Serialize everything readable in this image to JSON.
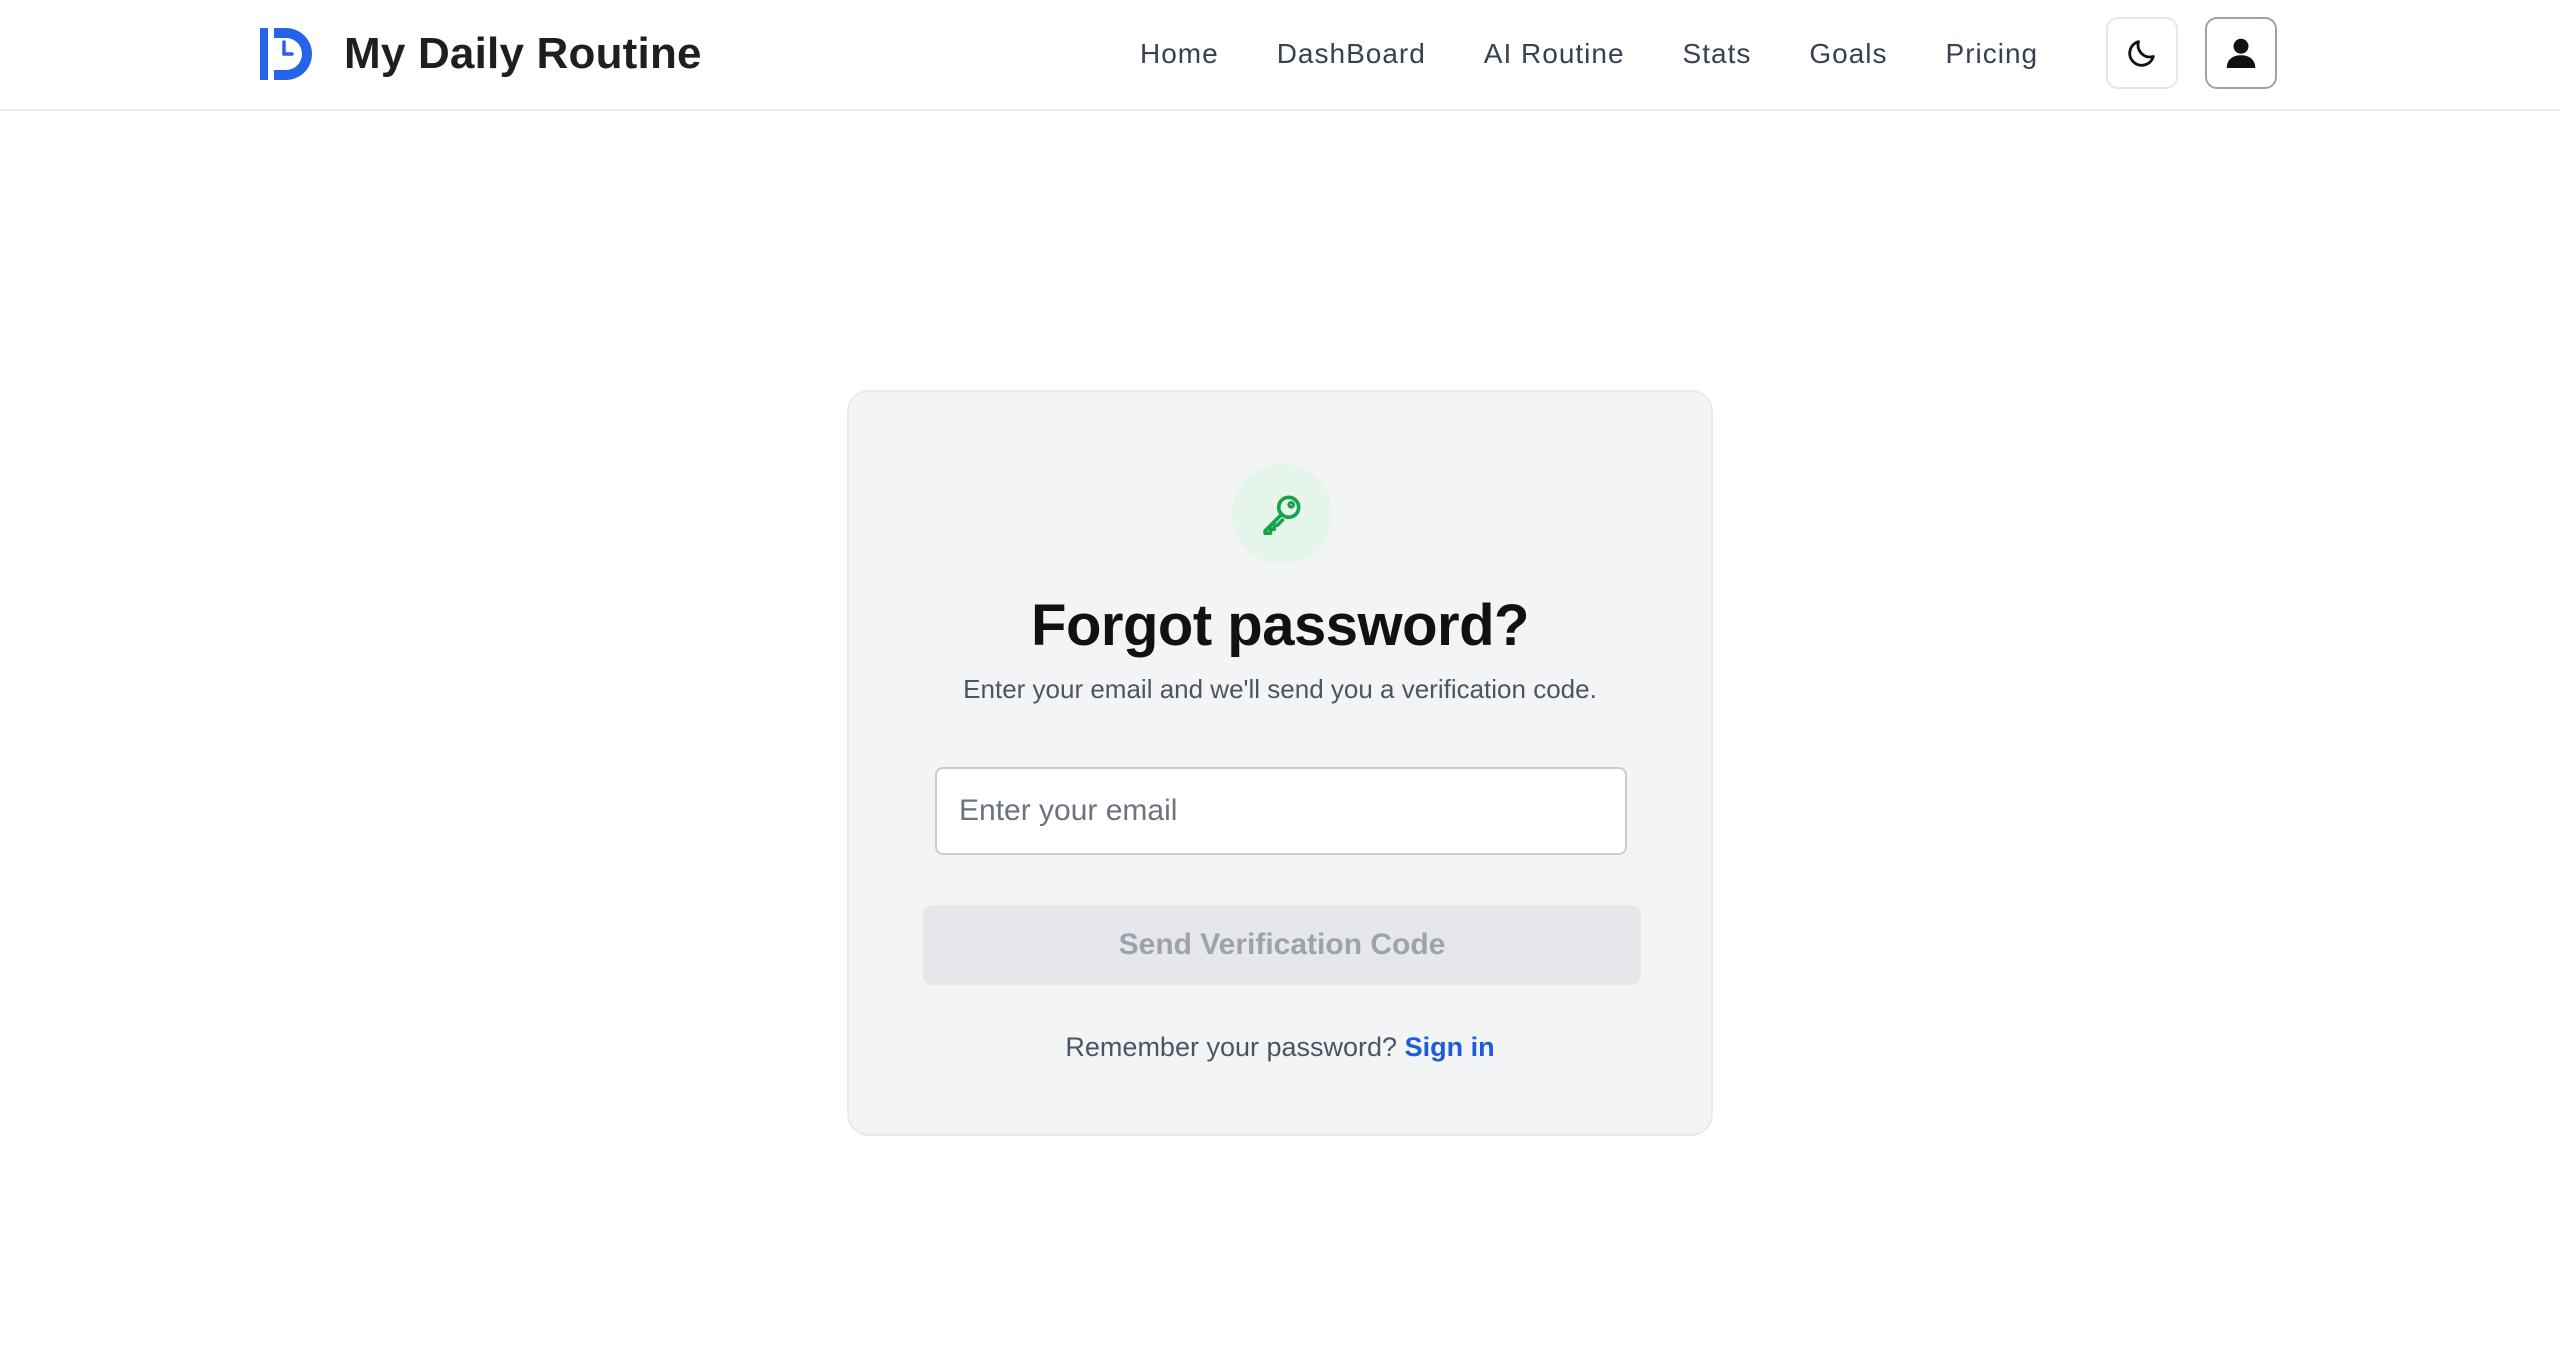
{
  "header": {
    "brand": "My Daily Routine",
    "logo_icon": "clock-d-logo-icon",
    "nav": [
      {
        "label": "Home"
      },
      {
        "label": "DashBoard"
      },
      {
        "label": "AI Routine"
      },
      {
        "label": "Stats"
      },
      {
        "label": "Goals"
      },
      {
        "label": "Pricing"
      }
    ],
    "theme_toggle_icon": "moon-icon",
    "user_menu_icon": "user-icon"
  },
  "card": {
    "icon": "key-icon",
    "title": "Forgot password?",
    "subtitle": "Enter your email and we'll send you a verification code.",
    "email": {
      "placeholder": "Enter your email",
      "value": ""
    },
    "send_button": {
      "label": "Send Verification Code",
      "disabled": true
    },
    "remember_text": "Remember your password?",
    "signin_label": "Sign in"
  },
  "colors": {
    "brand_blue": "#2563eb",
    "key_green": "#16a34a",
    "key_circle_bg": "#e6f5ea",
    "card_bg": "#f3f4f6",
    "link_blue": "#1d5bd8",
    "disabled_button_bg": "#e5e7eb",
    "disabled_button_text": "#9ca3af"
  }
}
